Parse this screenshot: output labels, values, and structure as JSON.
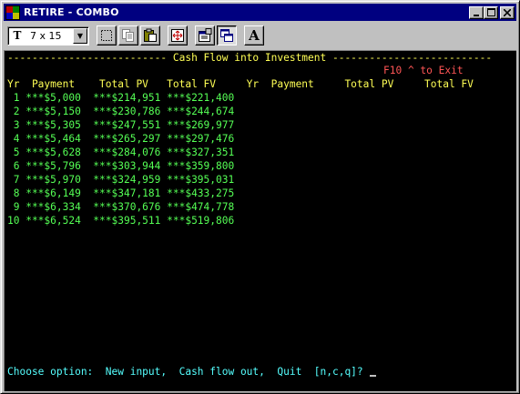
{
  "window": {
    "title": "RETIRE - COMBO"
  },
  "toolbar": {
    "font_size": "7 x 15",
    "buttons": [
      {
        "name": "mark-icon"
      },
      {
        "name": "copy-icon"
      },
      {
        "name": "paste-icon"
      },
      {
        "name": "fullscreen-icon"
      },
      {
        "name": "properties-icon"
      },
      {
        "name": "background-icon"
      },
      {
        "name": "font-icon",
        "glyph": "A"
      }
    ]
  },
  "console": {
    "header_line": "-------------------------- Cash Flow into Investment --------------------------",
    "exit_hint": "F10 ^ to Exit",
    "columns_line": "Yr  Payment    Total PV   Total FV     Yr  Payment     Total PV     Total FV",
    "rows": [
      " 1 ***$5,000  ***$214,951 ***$221,400",
      " 2 ***$5,150  ***$230,786 ***$244,674",
      " 3 ***$5,305  ***$247,551 ***$269,977",
      " 4 ***$5,464  ***$265,297 ***$297,476",
      " 5 ***$5,628  ***$284,076 ***$327,351",
      " 6 ***$5,796  ***$303,944 ***$359,800",
      " 7 ***$5,970  ***$324,959 ***$395,031",
      " 8 ***$6,149  ***$347,181 ***$433,275",
      " 9 ***$6,334  ***$370,676 ***$474,778",
      "10 ***$6,524  ***$395,511 ***$519,806"
    ],
    "prompt": "Choose option:  New input,  Cash flow out,  Quit  [n,c,q]?"
  },
  "colors": {
    "titlebar": "#000080",
    "header_text": "#ffff55",
    "data_text": "#55ff55",
    "exit_text": "#ff5555",
    "prompt_text": "#55ffff"
  }
}
